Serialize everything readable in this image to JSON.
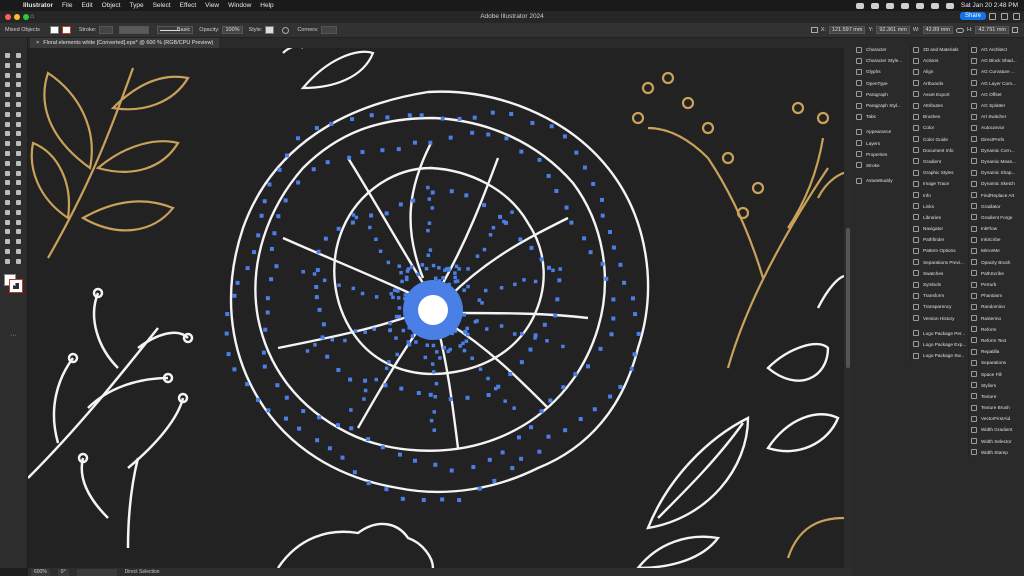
{
  "menubar": {
    "app_name": "Illustrator",
    "items": [
      "File",
      "Edit",
      "Object",
      "Type",
      "Select",
      "Effect",
      "View",
      "Window",
      "Help"
    ],
    "clock": "Sat Jan 20  2:48 PM"
  },
  "window": {
    "title": "Adobe Illustrator 2024",
    "share_label": "Share"
  },
  "control_bar": {
    "selection_label": "Mixed Objects",
    "stroke_label": "Stroke:",
    "brush_label": "Basic",
    "opacity_label": "Opacity:",
    "opacity_value": "100%",
    "style_label": "Style:",
    "corners_label": "Corners:",
    "x_label": "X:",
    "x_value": "121.597 mm",
    "y_label": "Y:",
    "y_value": "92.361 mm",
    "w_label": "W:",
    "w_value": "42.89 mm",
    "h_label": "H:",
    "h_value": "42.791 mm"
  },
  "document": {
    "tab_label": "Floral elements white [Converted].eps* @ 600 % (RGB/CPU Preview)"
  },
  "status": {
    "zoom": "600%",
    "rotation": "0°",
    "tool": "Direct Selection"
  },
  "colors": {
    "accent": "#1473e6",
    "anchor": "#4a7fe6",
    "gold": "#c9a15a",
    "canvas": "#222222"
  },
  "panels": {
    "col1": [
      {
        "label": "Character",
        "icon": "character-icon"
      },
      {
        "label": "Character Style...",
        "icon": "character-styles-icon"
      },
      {
        "label": "Glyphs",
        "icon": "glyphs-icon"
      },
      {
        "label": "OpenType",
        "icon": "opentype-icon"
      },
      {
        "label": "Paragraph",
        "icon": "paragraph-icon"
      },
      {
        "label": "Paragraph Styl...",
        "icon": "paragraph-styles-icon"
      },
      {
        "label": "Tabs",
        "icon": "tabs-icon"
      },
      {
        "gap": true
      },
      {
        "label": "Appearance",
        "icon": "appearance-icon"
      },
      {
        "label": "Layers",
        "icon": "layers-icon"
      },
      {
        "label": "Properties",
        "icon": "properties-icon"
      },
      {
        "label": "Stroke",
        "icon": "stroke-icon"
      },
      {
        "gap": true
      },
      {
        "label": "AstuteBuddy",
        "icon": "astutebuddy-icon"
      }
    ],
    "col2": [
      {
        "label": "3D and Materials",
        "icon": "3d-icon"
      },
      {
        "label": "Actions",
        "icon": "actions-icon"
      },
      {
        "label": "Align",
        "icon": "align-icon"
      },
      {
        "label": "Artboards",
        "icon": "artboards-icon"
      },
      {
        "label": "Asset Export",
        "icon": "asset-export-icon"
      },
      {
        "label": "Attributes",
        "icon": "attributes-icon"
      },
      {
        "label": "Brushes",
        "icon": "brushes-icon"
      },
      {
        "label": "Color",
        "icon": "color-icon"
      },
      {
        "label": "Color Guide",
        "icon": "color-guide-icon"
      },
      {
        "label": "Document Info",
        "icon": "document-info-icon"
      },
      {
        "label": "Gradient",
        "icon": "gradient-icon"
      },
      {
        "label": "Graphic Styles",
        "icon": "graphic-styles-icon"
      },
      {
        "label": "Image Trace",
        "icon": "image-trace-icon"
      },
      {
        "label": "Info",
        "icon": "info-icon"
      },
      {
        "label": "Links",
        "icon": "links-icon"
      },
      {
        "label": "Libraries",
        "icon": "libraries-icon"
      },
      {
        "label": "Navigator",
        "icon": "navigator-icon"
      },
      {
        "label": "Pathfinder",
        "icon": "pathfinder-icon"
      },
      {
        "label": "Pattern Options",
        "icon": "pattern-options-icon"
      },
      {
        "label": "Separations Previ...",
        "icon": "separations-icon"
      },
      {
        "label": "Swatches",
        "icon": "swatches-icon"
      },
      {
        "label": "Symbols",
        "icon": "symbols-icon"
      },
      {
        "label": "Transform",
        "icon": "transform-icon"
      },
      {
        "label": "Transparency",
        "icon": "transparency-icon"
      },
      {
        "label": "Version History",
        "icon": "version-history-icon"
      },
      {
        "gap": true
      },
      {
        "label": "Logo Package Per...",
        "icon": "logo-package-icon"
      },
      {
        "label": "Logo Package Exp...",
        "icon": "logo-package-icon"
      },
      {
        "label": "Logo Package Sw...",
        "icon": "logo-package-icon"
      }
    ],
    "col3": [
      {
        "label": "AG Architect",
        "icon": "plugin-icon"
      },
      {
        "label": "AG Block Shad...",
        "icon": "plugin-icon"
      },
      {
        "label": "AG Curvature ...",
        "icon": "plugin-icon"
      },
      {
        "label": "AG Layer Com...",
        "icon": "plugin-icon"
      },
      {
        "label": "AG Offset",
        "icon": "plugin-icon"
      },
      {
        "label": "AG Splatter",
        "icon": "plugin-icon"
      },
      {
        "label": "Art Switcher",
        "icon": "plugin-icon"
      },
      {
        "label": "Autocarvior",
        "icon": "plugin-icon"
      },
      {
        "label": "DirectPrefs",
        "icon": "plugin-icon"
      },
      {
        "label": "Dynamic Corn...",
        "icon": "plugin-icon"
      },
      {
        "label": "Dynamic Meas...",
        "icon": "plugin-icon"
      },
      {
        "label": "Dynamic Shap...",
        "icon": "plugin-icon"
      },
      {
        "label": "Dynamic Sketch",
        "icon": "plugin-icon"
      },
      {
        "label": "FindReplace Art",
        "icon": "plugin-icon"
      },
      {
        "label": "Gradiator",
        "icon": "plugin-icon"
      },
      {
        "label": "Gradient Forge",
        "icon": "plugin-icon"
      },
      {
        "label": "InkFlow",
        "icon": "plugin-icon"
      },
      {
        "label": "InkScribe",
        "icon": "plugin-icon"
      },
      {
        "label": "MirrorMe",
        "icon": "plugin-icon"
      },
      {
        "label": "Opacity Brush",
        "icon": "plugin-icon"
      },
      {
        "label": "PathScribe",
        "icon": "plugin-icon"
      },
      {
        "label": "Perturb",
        "icon": "plugin-icon"
      },
      {
        "label": "Phantasm",
        "icon": "plugin-icon"
      },
      {
        "label": "Randomino",
        "icon": "plugin-icon"
      },
      {
        "label": "Rasterino",
        "icon": "plugin-icon"
      },
      {
        "label": "Reform",
        "icon": "plugin-icon"
      },
      {
        "label": "Reform Text",
        "icon": "plugin-icon"
      },
      {
        "label": "Repatilla",
        "icon": "plugin-icon"
      },
      {
        "label": "Separations",
        "icon": "plugin-icon"
      },
      {
        "label": "Space Fill",
        "icon": "plugin-icon"
      },
      {
        "label": "Stylism",
        "icon": "plugin-icon"
      },
      {
        "label": "Texture",
        "icon": "plugin-icon"
      },
      {
        "label": "Texture Brush",
        "icon": "plugin-icon"
      },
      {
        "label": "VectorFirstAid",
        "icon": "plugin-icon"
      },
      {
        "label": "Width Gradient",
        "icon": "plugin-icon"
      },
      {
        "label": "Width Selector",
        "icon": "plugin-icon"
      },
      {
        "label": "Width Stamp",
        "icon": "plugin-icon"
      }
    ]
  }
}
